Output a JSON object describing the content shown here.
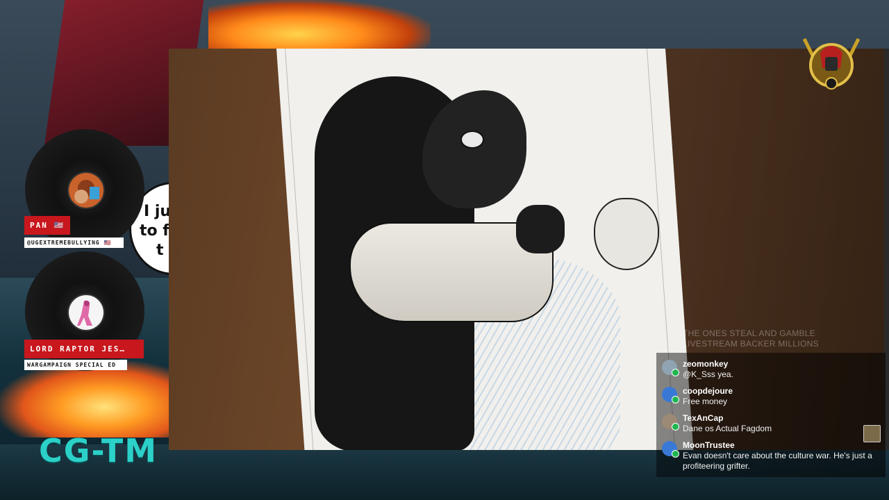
{
  "background": {
    "speech_bubble_text": [
      "I ju",
      "to f",
      "t"
    ],
    "logo_text": "CG-TM"
  },
  "video": {
    "watermark_lines": [
      "THE ONES STEAL AND GAMBLE",
      "LIVESTREAM BACKER MILLIONS"
    ]
  },
  "guests": [
    {
      "name": "PAN 🇺🇸",
      "handle": "@UGEXTREMEBULLYING 🇺🇸"
    },
    {
      "name": "LORD RAPTOR JES…",
      "handle": "WARGAMPAIGN SPECIAL ED"
    }
  ],
  "chat": {
    "messages": [
      {
        "user": "zeomonkey",
        "text": "@K_Sss yea.",
        "avatar_color": "#8fa3b3"
      },
      {
        "user": "coopdejoure",
        "text": "Free money",
        "avatar_color": "#3a78d6"
      },
      {
        "user": "TexAnCap",
        "text": "Dane os Actual Fagdom",
        "avatar_color": "#9d8a74"
      },
      {
        "user": "MoonTrustee",
        "text": "Evan doesn't care about the culture war. He's just a profiteering grifter.",
        "avatar_color": "#3a78d6"
      }
    ]
  },
  "colors": {
    "chat_online_dot": "#1fb64f",
    "guest_name_bg": "#c8171d",
    "logo": "#2bd1c8"
  }
}
